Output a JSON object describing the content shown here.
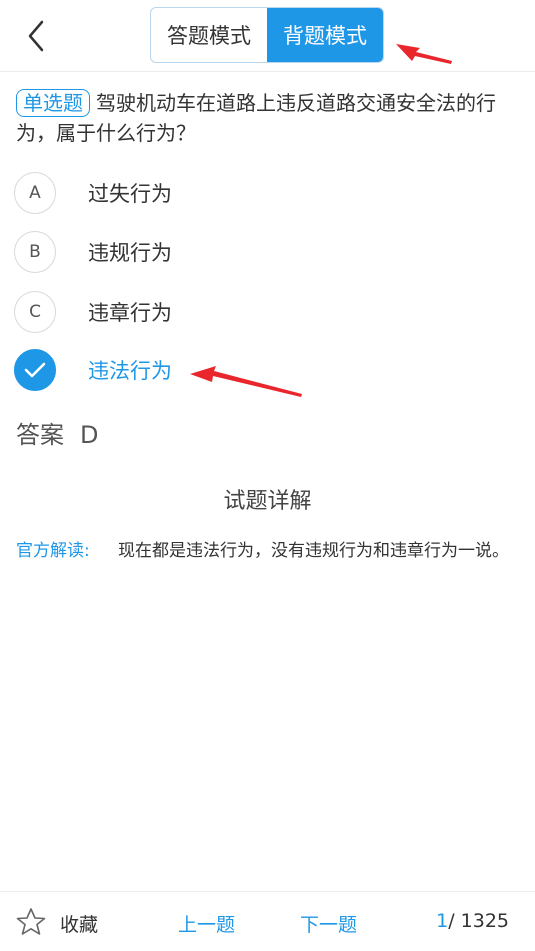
{
  "header": {
    "modes": [
      {
        "label": "答题模式",
        "active": false
      },
      {
        "label": "背题模式",
        "active": true
      }
    ]
  },
  "question": {
    "type_badge": "单选题",
    "text": "驾驶机动车在道路上违反道路交通安全法的行为，属于什么行为？"
  },
  "options": [
    {
      "letter": "A",
      "text": "过失行为",
      "selected": false
    },
    {
      "letter": "B",
      "text": "违规行为",
      "selected": false
    },
    {
      "letter": "C",
      "text": "违章行为",
      "selected": false
    },
    {
      "letter": "D",
      "text": "违法行为",
      "selected": true
    }
  ],
  "answer": {
    "label": "答案",
    "value": "D"
  },
  "detail": {
    "title": "试题详解",
    "official_label": "官方解读:",
    "official_text": "现在都是违法行为，没有违规行为和违章行为一说。"
  },
  "footer": {
    "favorite_label": "收藏",
    "prev_label": "上一题",
    "next_label": "下一题",
    "current_page": "1",
    "total_pages": "/ 1325"
  },
  "colors": {
    "accent": "#1f97e7",
    "annotation_arrow": "#e8262b"
  },
  "icons": {
    "back": "chevron-left-icon",
    "favorite": "star-outline-icon",
    "selected": "checkmark-icon"
  }
}
